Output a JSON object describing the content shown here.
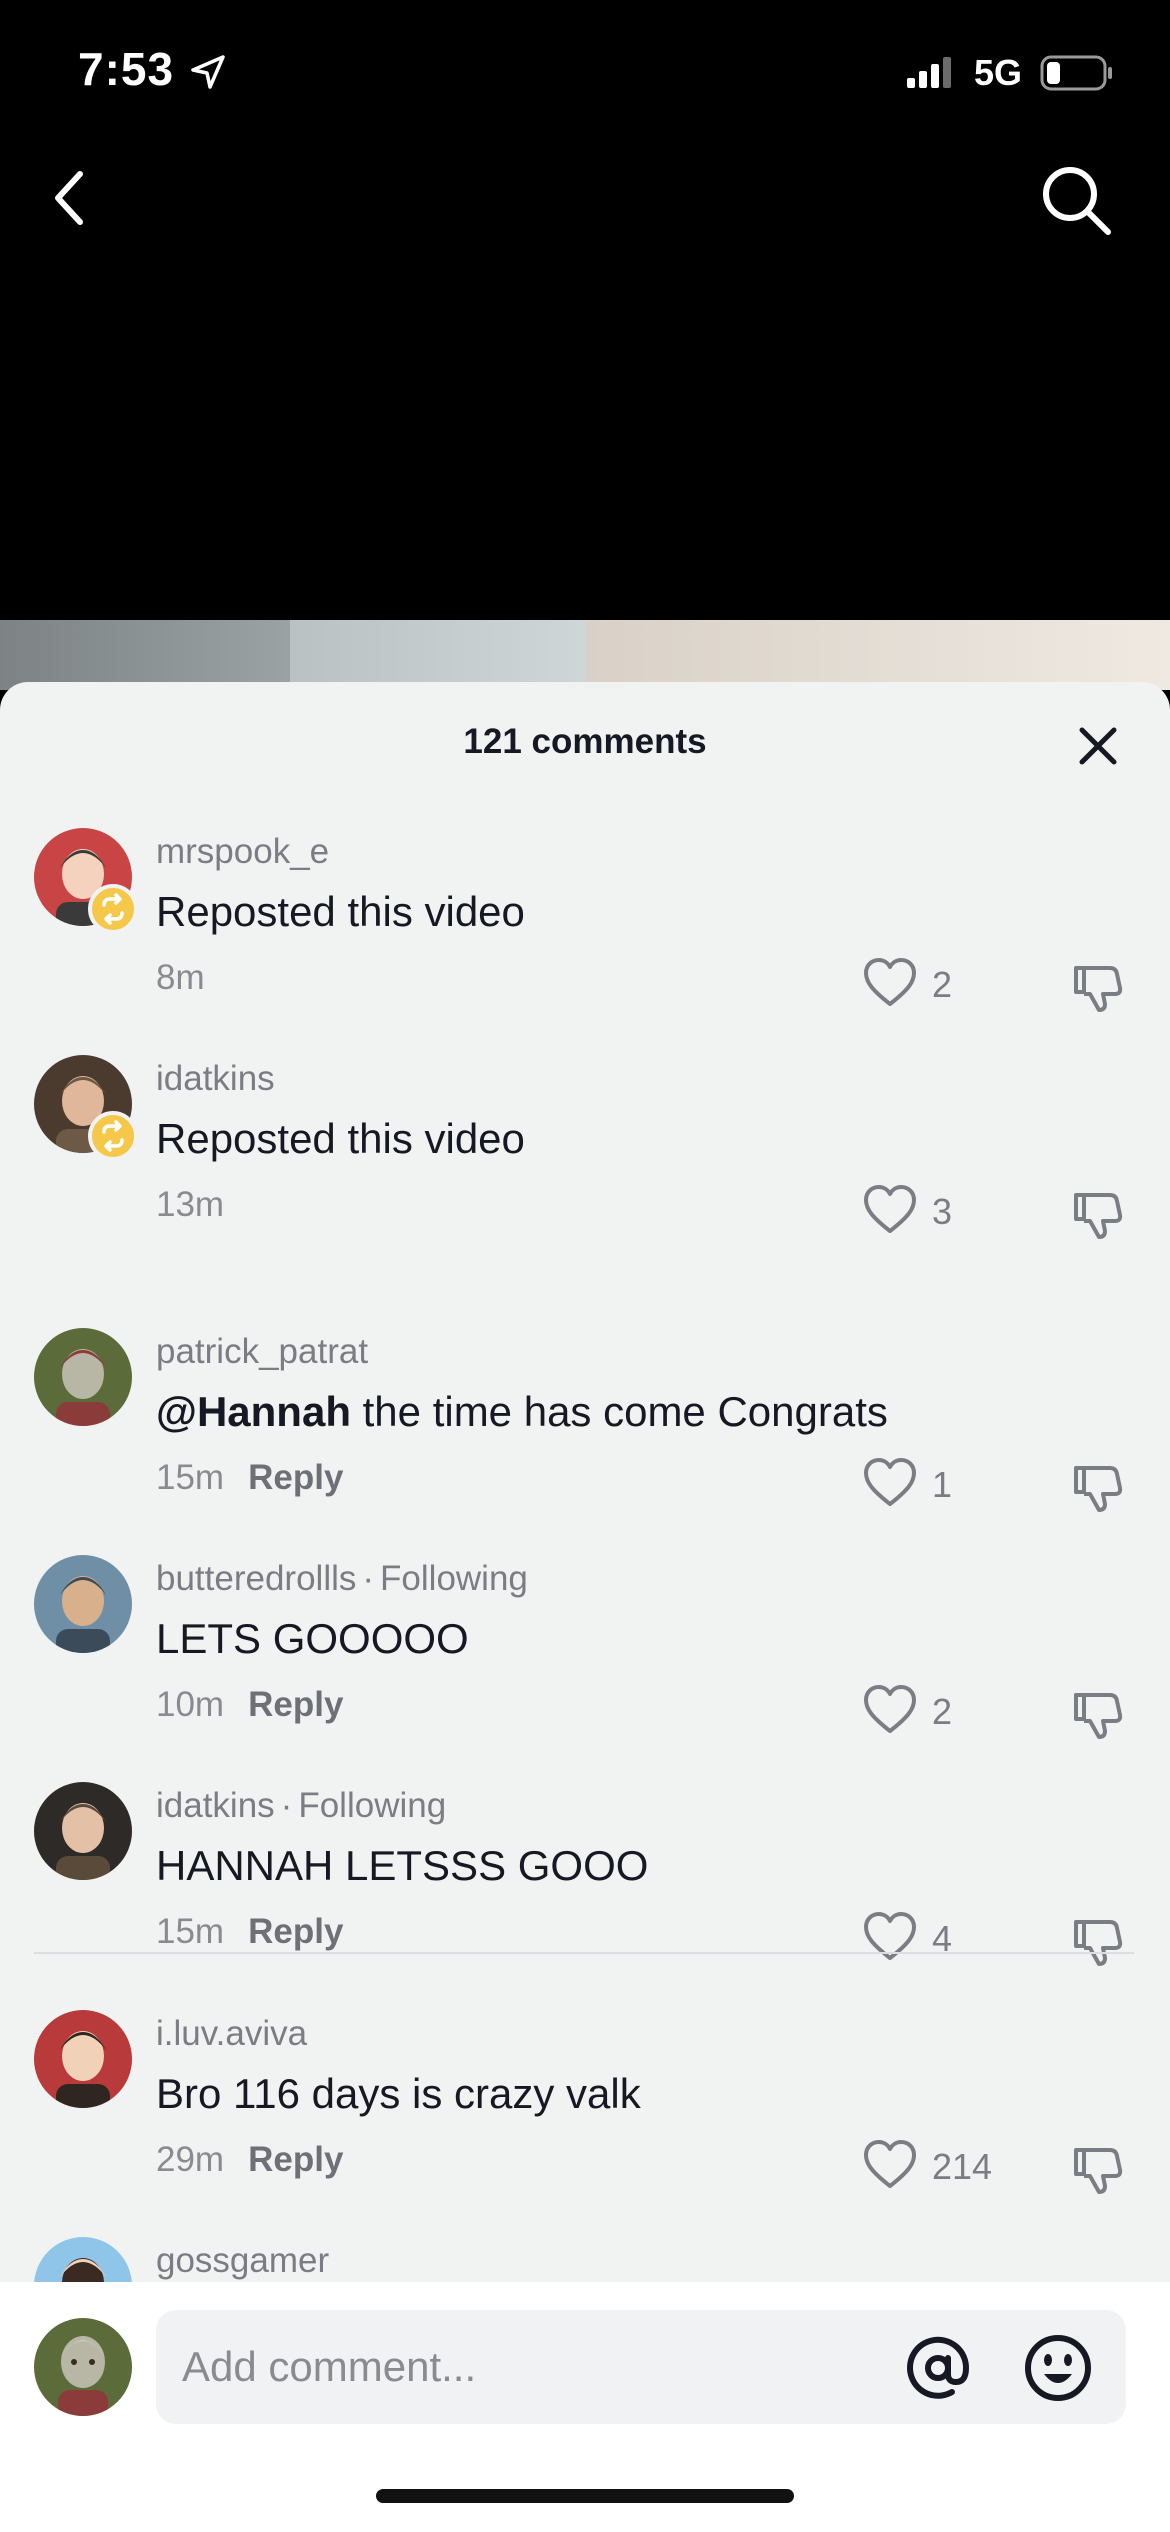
{
  "status_bar": {
    "time": "7:53",
    "network": "5G"
  },
  "sheet": {
    "title": "121 comments"
  },
  "comments": [
    {
      "username": "mrspook_e",
      "following": "",
      "mention": "",
      "text": "Reposted this video",
      "time": "8m",
      "reply_label": "",
      "likes": "2",
      "repost": true,
      "avatar_colors": [
        "#c94545",
        "#f4d2be",
        "#3a3a3a"
      ]
    },
    {
      "username": "idatkins",
      "following": "",
      "mention": "",
      "text": "Reposted this video",
      "time": "13m",
      "reply_label": "",
      "likes": "3",
      "repost": true,
      "avatar_colors": [
        "#4a3b2e",
        "#e0b79a",
        "#6c5a46"
      ]
    },
    {
      "username": "patrick_patrat",
      "following": "",
      "mention": "@Hannah",
      "text": " the time has come Congrats",
      "time": "15m",
      "reply_label": "Reply",
      "likes": "1",
      "repost": false,
      "avatar_colors": [
        "#5b6b3a",
        "#b8b7a6",
        "#8c3b3b"
      ]
    },
    {
      "username": "butteredrollls",
      "following": "Following",
      "mention": "",
      "text": "LETS GOOOOO",
      "time": "10m",
      "reply_label": "Reply",
      "likes": "2",
      "repost": false,
      "avatar_colors": [
        "#6e8fa6",
        "#d9b08c",
        "#3b4b5a"
      ]
    },
    {
      "username": "idatkins",
      "following": "Following",
      "mention": "",
      "text": "HANNAH LETSSS GOOO",
      "time": "15m",
      "reply_label": "Reply",
      "likes": "4",
      "repost": false,
      "avatar_colors": [
        "#2e2a27",
        "#e4c1a6",
        "#5a4a3a"
      ]
    },
    {
      "username": "i.luv.aviva",
      "following": "",
      "mention": "",
      "text": "Bro 116 days is crazy valk",
      "time": "29m",
      "reply_label": "Reply",
      "likes": "214",
      "repost": false,
      "avatar_colors": [
        "#b83a3a",
        "#f1d1b8",
        "#2f2622"
      ]
    },
    {
      "username": "gossgamer",
      "following": "",
      "mention": "",
      "text": "",
      "time": "",
      "reply_label": "",
      "likes": "",
      "repost": false,
      "avatar_colors": [
        "#8ec5e8",
        "#3a2a22",
        "#f1d1b8"
      ]
    }
  ],
  "input": {
    "placeholder": "Add comment..."
  },
  "icons": [
    "location-arrow-icon",
    "signal-icon",
    "battery-icon",
    "back-chevron-icon",
    "search-icon",
    "close-icon",
    "repost-icon",
    "heart-icon",
    "dislike-icon",
    "mention-icon",
    "emoji-icon"
  ]
}
